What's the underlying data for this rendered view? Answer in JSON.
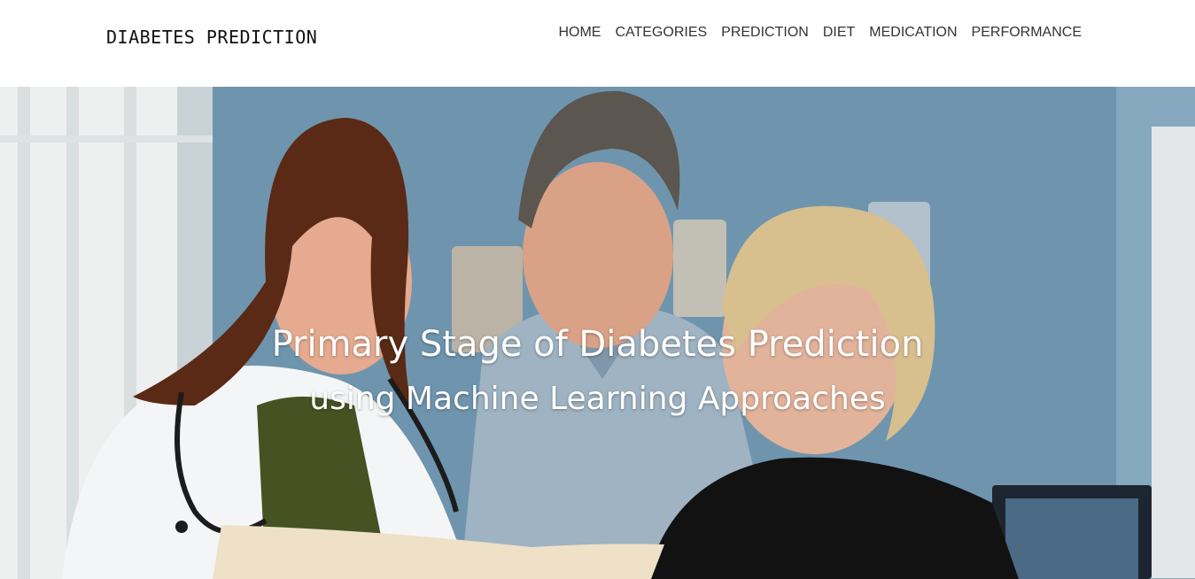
{
  "brand": "DIABETES PREDICTION",
  "nav": {
    "items": [
      {
        "label": "HOME"
      },
      {
        "label": "CATEGORIES"
      },
      {
        "label": "PREDICTION"
      },
      {
        "label": "DIET"
      },
      {
        "label": "MEDICATION"
      },
      {
        "label": "PERFORMANCE"
      }
    ]
  },
  "hero": {
    "title": "Primary Stage of Diabetes Prediction",
    "subtitle": "using Machine Learning Approaches",
    "image_description_icon": "doctor-patients-photo"
  },
  "colors": {
    "nav_bg": "#ffffff",
    "nav_text": "#333333",
    "hero_text": "#ffffff",
    "wall": "#7096b0"
  }
}
